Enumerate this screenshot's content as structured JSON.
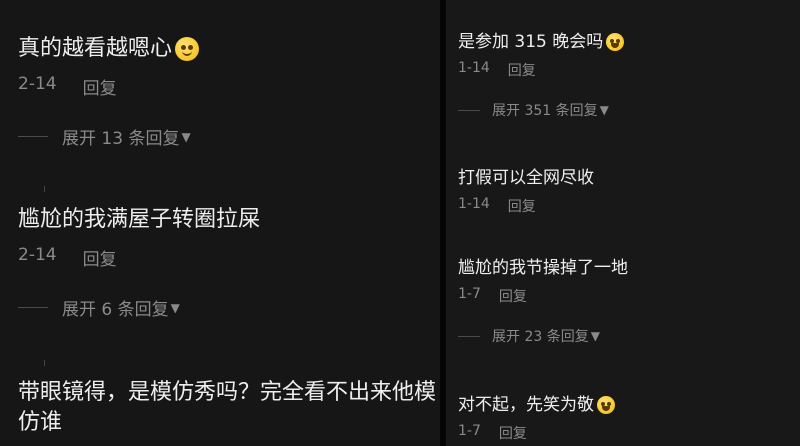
{
  "left": {
    "comments": [
      {
        "text": "真的越看越嗯心",
        "date": "2-14",
        "reply": "回复",
        "expand": "展开 13 条回复",
        "emoji": "smile-face-icon"
      },
      {
        "text": "尴尬的我满屋子转圈拉屎",
        "date": "2-14",
        "reply": "回复",
        "expand": "展开 6 条回复"
      },
      {
        "text": "带眼镜得，是模仿秀吗？完全看不出来他模仿谁"
      }
    ]
  },
  "right": {
    "comments": [
      {
        "text": "是参加 315 晚会吗",
        "date": "1-14",
        "reply": "回复",
        "expand": "展开 351 条回复",
        "emoji": "laughing-face-icon"
      },
      {
        "text": "打假可以全网尽收",
        "date": "1-14",
        "reply": "回复"
      },
      {
        "text": "尴尬的我节操掉了一地",
        "date": "1-7",
        "reply": "回复",
        "expand": "展开 23 条回复"
      },
      {
        "text": "对不起，先笑为敬",
        "date": "1-7",
        "reply": "回复",
        "emoji": "laughing-face-icon"
      }
    ]
  }
}
